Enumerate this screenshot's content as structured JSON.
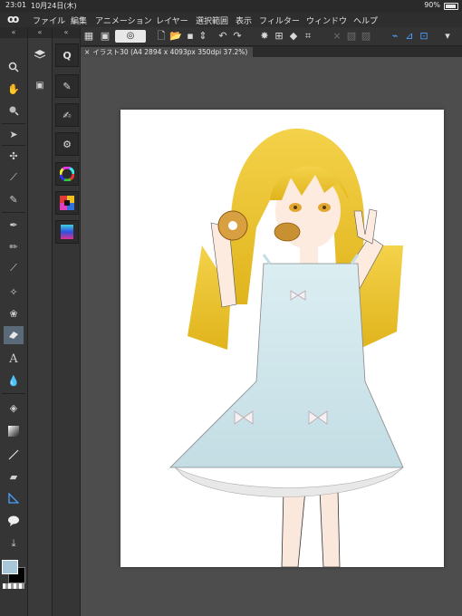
{
  "status_bar": {
    "time": "23:01",
    "date": "10月24日(木)",
    "battery": "90%"
  },
  "menu_bar": {
    "logo": "ꝏ",
    "items": [
      "ファイル",
      "編集",
      "アニメーション",
      "レイヤー",
      "選択範囲",
      "表示",
      "フィルター",
      "ウィンドウ",
      "ヘルプ"
    ]
  },
  "tool_column": {
    "header_left": "«",
    "header_right": "«",
    "tools": [
      "zoom-icon",
      "hand-icon",
      "magnify-icon",
      "operation-icon",
      "move-icon",
      "eyedropper-icon",
      "pen-icon",
      "pencil-icon",
      "brush-icon",
      "airbrush-icon",
      "decoration-icon",
      "eraser-icon",
      "text-icon",
      "blend-icon",
      "fill-icon",
      "gradient-icon",
      "figure-icon",
      "frame-icon",
      "ruler-icon",
      "balloon-icon",
      "line-correction-icon"
    ],
    "text_tool_glyph": "A"
  },
  "canvas_tab": {
    "label": "イラスト30 (A4 2894 x 4093px 350dpi 37.2%)",
    "close": "×"
  },
  "colors": {
    "main_color": "#a7c7d6",
    "sub_color": "#000000",
    "accent_active": "#5a6a78",
    "command_blue": "#4aa0ff"
  }
}
